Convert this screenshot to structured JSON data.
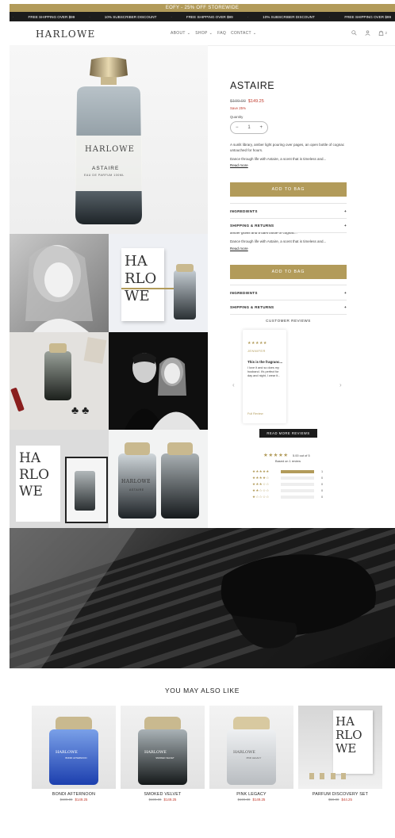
{
  "promo_bar": {
    "text": "EOFY - 25% OFF STOREWIDE"
  },
  "marquee": {
    "items": [
      "FREE SHIPPING OVER $99",
      "10% SUBSCRIBER DISCOUNT",
      "FREE SHIPPING OVER $99",
      "10% SUBSCRIBER DISCOUNT",
      "FREE SHIPPING OVER $99"
    ]
  },
  "header": {
    "logo": "HARLOWE",
    "nav": [
      {
        "label": "ABOUT",
        "has_dropdown": true
      },
      {
        "label": "SHOP",
        "has_dropdown": true
      },
      {
        "label": "FAQ",
        "has_dropdown": false
      },
      {
        "label": "CONTACT",
        "has_dropdown": true
      }
    ],
    "icons": [
      "search-icon",
      "account-icon",
      "cart-icon"
    ],
    "cart_count": "2"
  },
  "gallery": {
    "hero_label": "HARLOWE",
    "hero_product_name": "ASTAIRE",
    "hero_subtitle": "EAU DE PARFUM 100ML",
    "box_text": [
      "HA",
      "RLO",
      "WE"
    ],
    "tile_bottle_label": "HARLOWE",
    "tile_bottle_product": "ASTAIRE"
  },
  "product": {
    "title": "ASTAIRE",
    "price_old": "$199.00",
    "price_new": "$149.25",
    "save": "Save 25%",
    "quantity_label": "Quantity",
    "quantity": "1",
    "minus": "−",
    "plus": "+",
    "description_1": "A sunlit library, amber light pouring over pages, an open bottle of cognac untouched for hours.",
    "description_2": "Dance through life with Astaire, a scent that is timeless and...",
    "read_more": "Read more",
    "add_to_bag": "ADD TO BAG",
    "accordion": [
      {
        "label": "INGREDIENTS",
        "icon": "+"
      },
      {
        "label": "SHIPPING & RETURNS",
        "icon": "+"
      }
    ],
    "sticky_desc_partial": "amber glows and a dark bottle of cognac...",
    "sticky_description_2": "Dance through life with Astaire, a scent that is timeless and...",
    "sticky_read_more": "Read more",
    "sticky_add_to_bag": "ADD TO BAG",
    "sticky_accordion": [
      {
        "label": "INGREDIENTS",
        "icon": "+"
      },
      {
        "label": "SHIPPING & RETURNS",
        "icon": "+"
      }
    ]
  },
  "reviews": {
    "heading": "CUSTOMER REVIEWS",
    "card": {
      "stars": "★★★★★",
      "author": "JENNIFER",
      "title": "This is the fragranc...",
      "body": "I love it and so does my husband. It's perfect for day and night, I wear it...",
      "full_review": "Full Review"
    },
    "prev": "‹",
    "next": "›",
    "read_more_button": "READ MORE REVIEWS",
    "summary_stars": "★★★★★",
    "summary_text": "5.00 out of 5",
    "summary_sub": "Based on 1 review",
    "histogram": [
      {
        "stars": "★★★★★",
        "count": "1",
        "fraction": 1.0
      },
      {
        "stars": "★★★★☆",
        "count": "0",
        "fraction": 0
      },
      {
        "stars": "★★★☆☆",
        "count": "0",
        "fraction": 0
      },
      {
        "stars": "★★☆☆☆",
        "count": "0",
        "fraction": 0
      },
      {
        "stars": "★☆☆☆☆",
        "count": "0",
        "fraction": 0
      }
    ]
  },
  "also_like": {
    "title": "YOU MAY ALSO LIKE",
    "products": [
      {
        "name": "BONDI AFTERNOON",
        "price_old": "$199.00",
        "price_new": "$149.25",
        "label": "HARLOWE",
        "sub": "BONDI AFTERNOON"
      },
      {
        "name": "SMOKED VELVET",
        "price_old": "$199.00",
        "price_new": "$149.25",
        "label": "HARLOWE",
        "sub": "SMOKED VELVET"
      },
      {
        "name": "PINK LEGACY",
        "price_old": "$199.00",
        "price_new": "$149.25",
        "label": "HARLOWE",
        "sub": "PINK LEGACY"
      },
      {
        "name": "PARFUM DISCOVERY SET",
        "price_old": "$59.00",
        "price_new": "$44.25",
        "label": "HA RLO WE",
        "sub": ""
      }
    ]
  },
  "colors": {
    "accent": "#b29b5a",
    "sale": "#c0392b",
    "dark": "#1c1c1c"
  }
}
